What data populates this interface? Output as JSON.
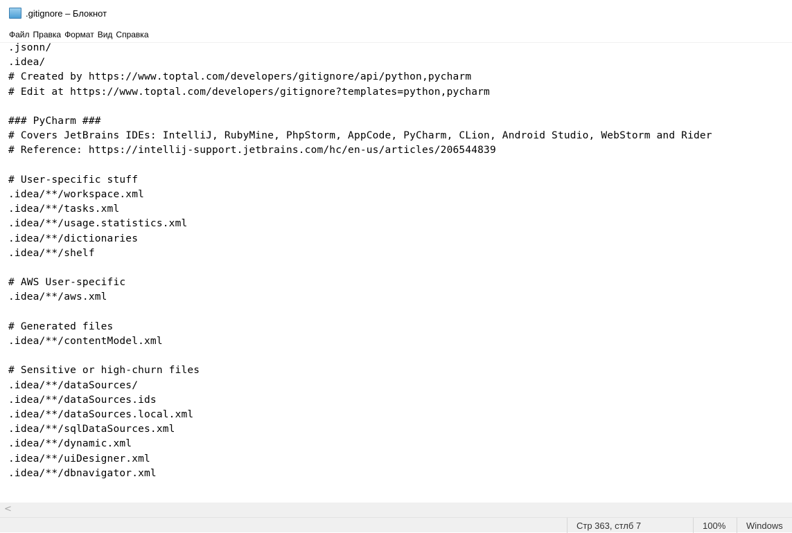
{
  "window": {
    "title": ".gitignore – Блокнот"
  },
  "menu": [
    "Файл",
    "Правка",
    "Формат",
    "Вид",
    "Справка"
  ],
  "editor": {
    "content": ".jsonn/\n.idea/\n# Created by https://www.toptal.com/developers/gitignore/api/python,pycharm\n# Edit at https://www.toptal.com/developers/gitignore?templates=python,pycharm\n\n### PyCharm ###\n# Covers JetBrains IDEs: IntelliJ, RubyMine, PhpStorm, AppCode, PyCharm, CLion, Android Studio, WebStorm and Rider\n# Reference: https://intellij-support.jetbrains.com/hc/en-us/articles/206544839\n\n# User-specific stuff\n.idea/**/workspace.xml\n.idea/**/tasks.xml\n.idea/**/usage.statistics.xml\n.idea/**/dictionaries\n.idea/**/shelf\n\n# AWS User-specific\n.idea/**/aws.xml\n\n# Generated files\n.idea/**/contentModel.xml\n\n# Sensitive or high-churn files\n.idea/**/dataSources/\n.idea/**/dataSources.ids\n.idea/**/dataSources.local.xml\n.idea/**/sqlDataSources.xml\n.idea/**/dynamic.xml\n.idea/**/uiDesigner.xml\n.idea/**/dbnavigator.xml"
  },
  "scrollbar": {
    "left_arrow": "<"
  },
  "status": {
    "position": "Стр 363, стлб 7",
    "zoom": "100%",
    "line_ending": "Windows"
  },
  "icons": {
    "app": "notepad-icon",
    "scroll_left": "chevron-left-icon"
  }
}
